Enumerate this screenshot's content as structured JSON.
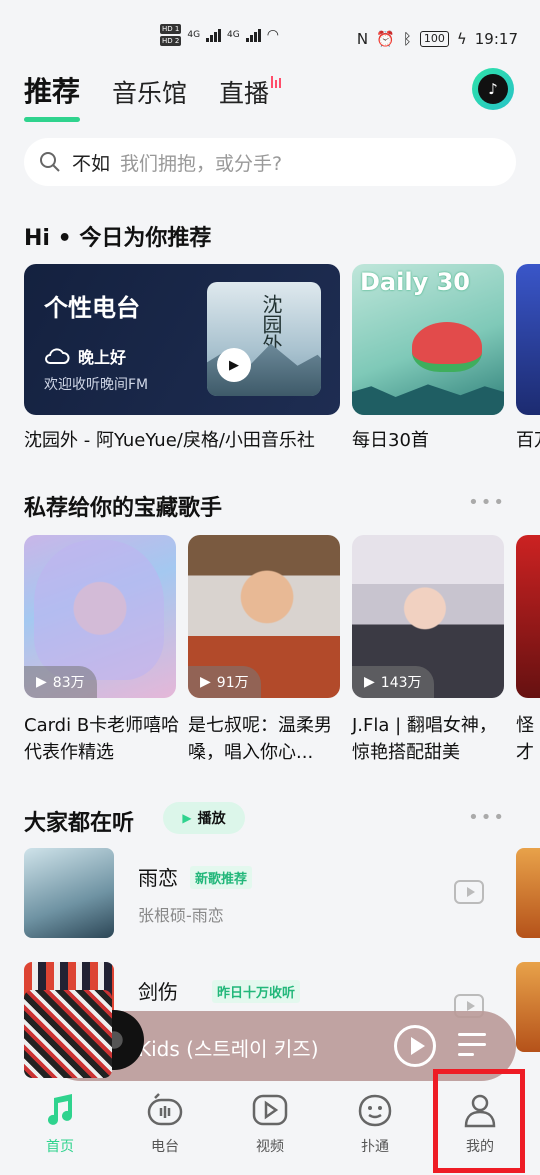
{
  "status": {
    "sim1": "HD 1",
    "sim2": "HD 2",
    "net": "4G",
    "battery": "100",
    "time": "19:17"
  },
  "tabs": [
    {
      "label": "推荐",
      "active": true
    },
    {
      "label": "音乐馆",
      "active": false
    },
    {
      "label": "直播",
      "active": false
    }
  ],
  "search": {
    "query": "不如",
    "placeholder": "我们拥抱，或分手?"
  },
  "rec": {
    "title": "Hi • 今日为你推荐",
    "radio": {
      "title": "个性电台",
      "greeting": "晚上好",
      "subtitle": "欢迎收听晚间FM",
      "cover_text": "沈园外"
    },
    "daily": {
      "badge": "Daily 30"
    },
    "captions": [
      "沈园外 - 阿YueYue/戾格/小田音乐社",
      "每日30首",
      "百万"
    ]
  },
  "singers": {
    "title": "私荐给你的宝藏歌手",
    "items": [
      {
        "count": "83万",
        "caption": "Cardi B卡老师嘻哈代表作精选"
      },
      {
        "count": "91万",
        "caption": "是七叔呢：温柔男嗓，唱入你心..."
      },
      {
        "count": "143万",
        "caption": "J.Fla | 翻唱女神，惊艳搭配甜美"
      },
      {
        "count": "",
        "caption": "怪才写印"
      }
    ]
  },
  "listening": {
    "title": "大家都在听",
    "play_label": "播放",
    "songs": [
      {
        "title": "雨恋",
        "tag": "新歌推荐",
        "artist": "张根硕-雨恋"
      },
      {
        "title": "剑伤",
        "tag": "昨日十万收听",
        "artist": ""
      }
    ]
  },
  "player": {
    "now_playing": "Kids (스트레이 키즈)"
  },
  "nav": [
    {
      "label": "首页",
      "icon": "music-note-icon",
      "active": true
    },
    {
      "label": "电台",
      "icon": "radio-icon",
      "active": false
    },
    {
      "label": "视频",
      "icon": "video-icon",
      "active": false
    },
    {
      "label": "扑通",
      "icon": "putong-icon",
      "active": false
    },
    {
      "label": "我的",
      "icon": "profile-icon",
      "active": false
    }
  ],
  "colors": {
    "accent": "#2fd38e",
    "highlight": "#ee1c25"
  }
}
